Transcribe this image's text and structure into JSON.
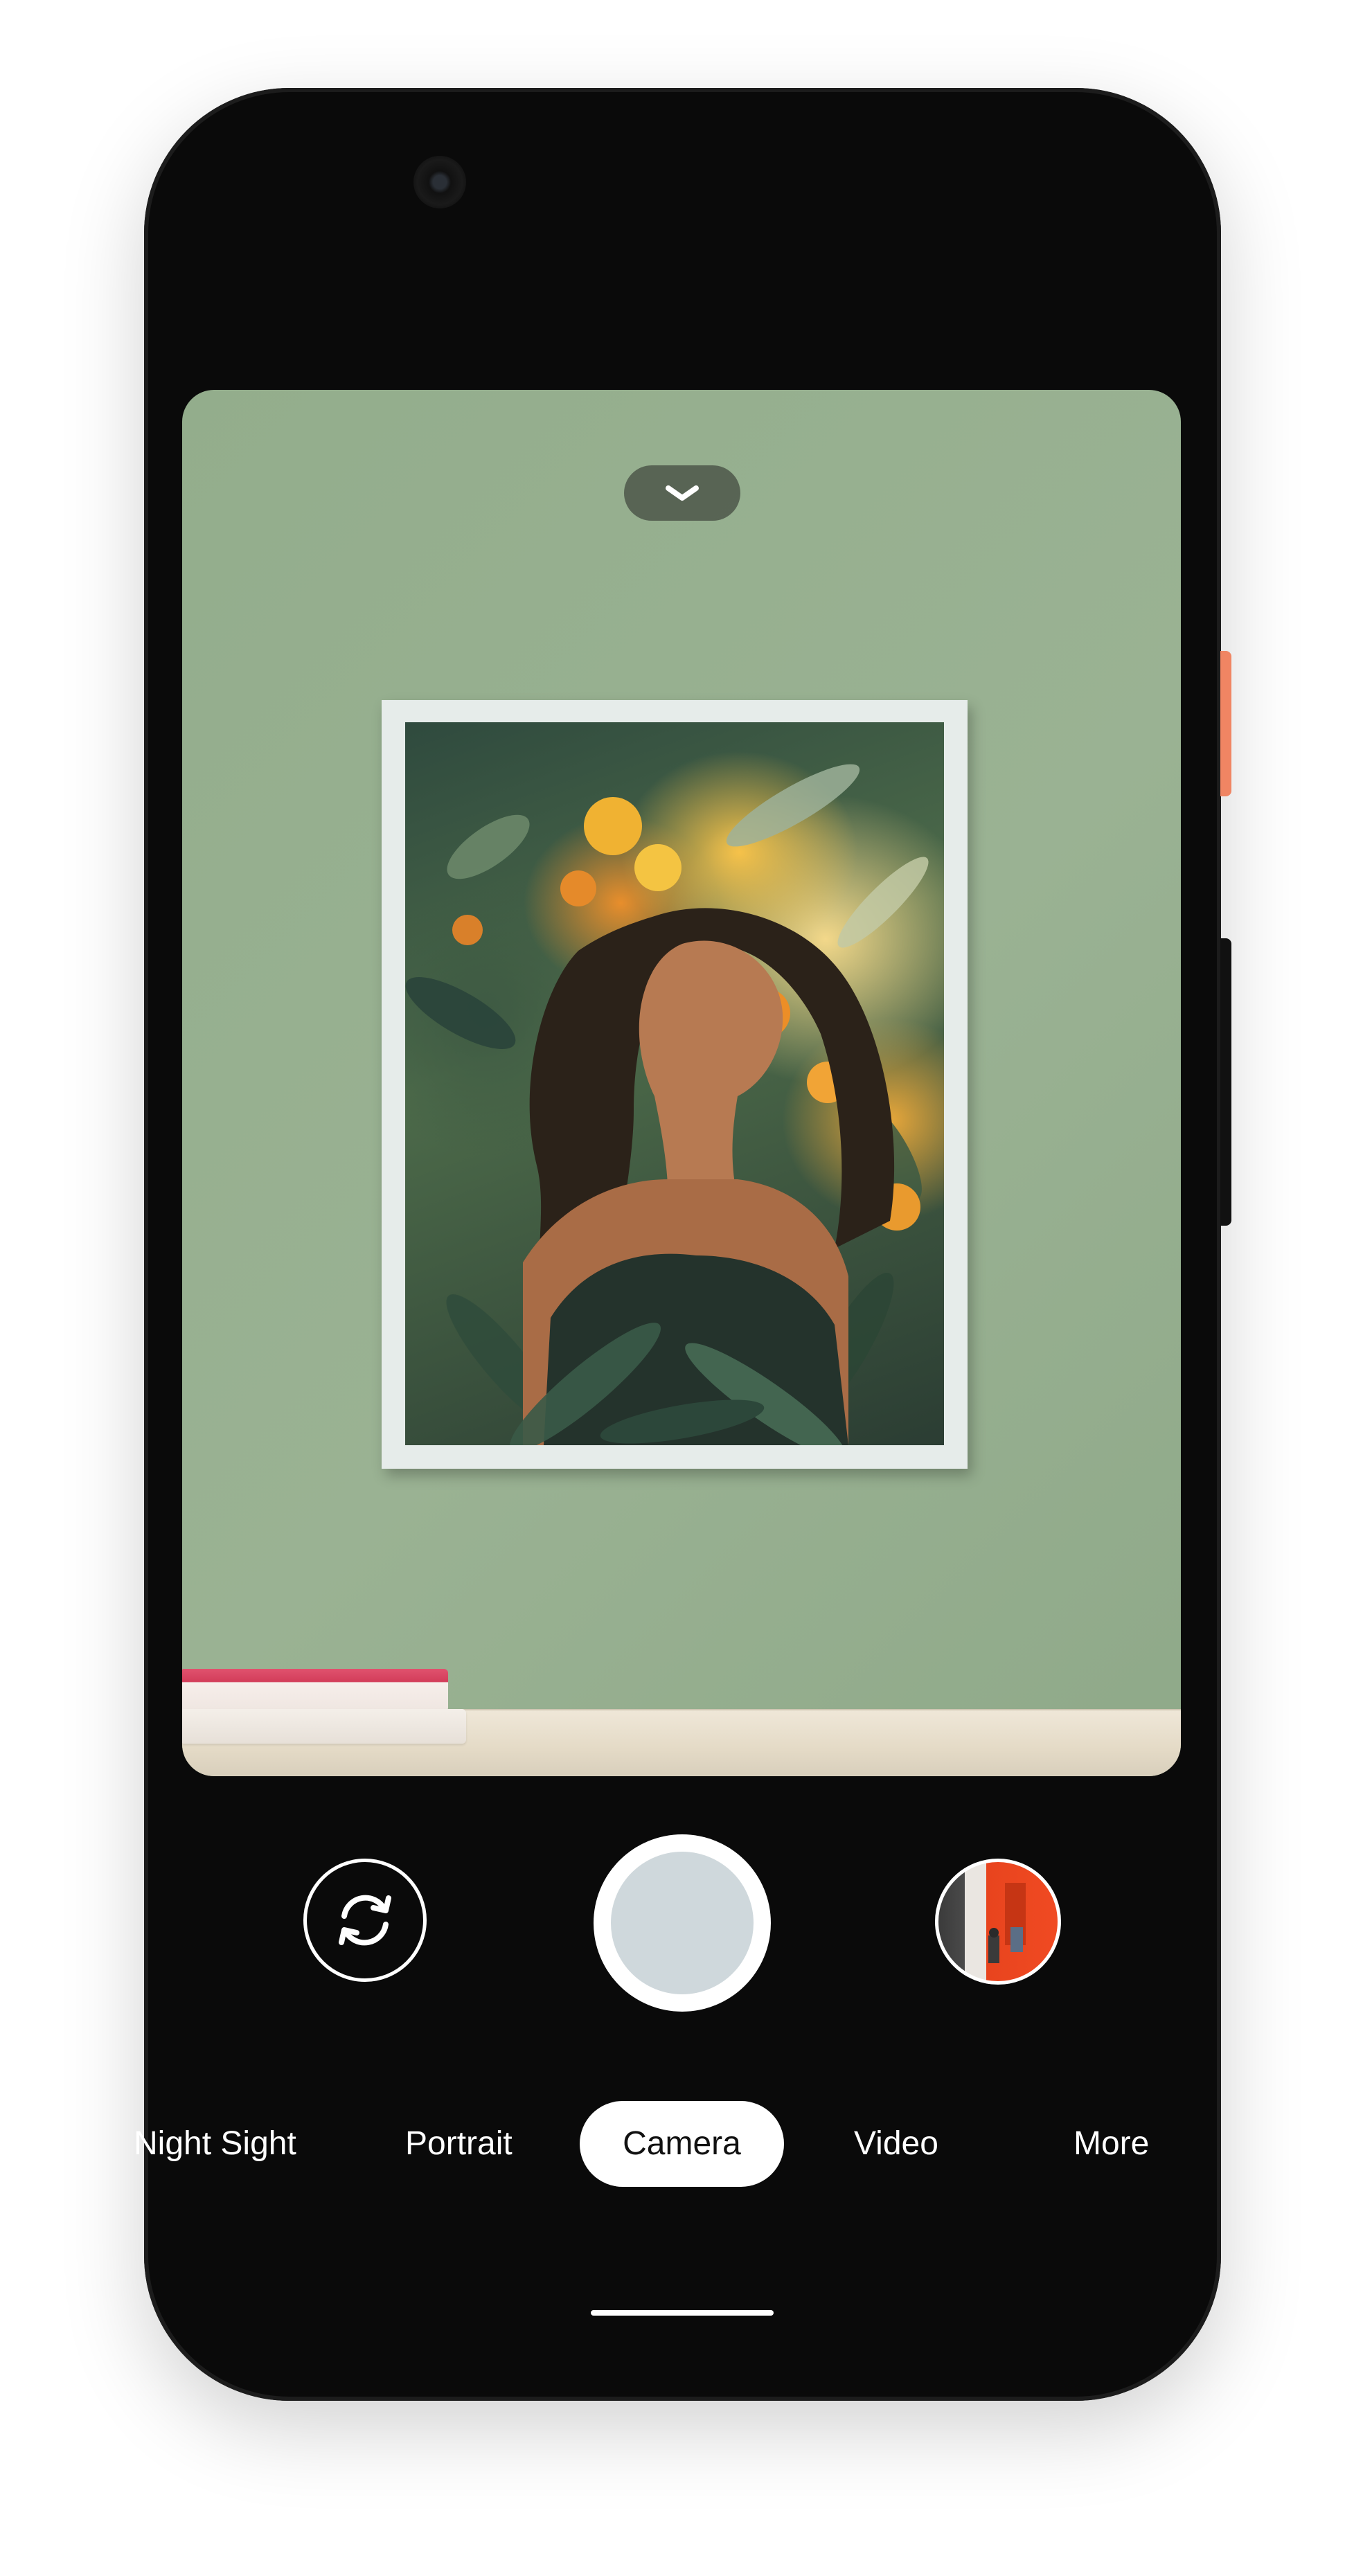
{
  "device": {
    "accent_side_key_color": "#f08563",
    "body_color": "#0a0a0a"
  },
  "viewfinder": {
    "collapse_icon": "chevron-down-icon",
    "scene": {
      "wall_color": "#93ad8c",
      "book_color": "#d33d5a"
    }
  },
  "controls": {
    "flip_icon": "camera-flip-icon",
    "shutter_color": "#cfd8dc",
    "gallery_icon": "last-photo-thumbnail"
  },
  "modes": {
    "items": [
      {
        "label": "Night Sight"
      },
      {
        "label": "Portrait"
      },
      {
        "label": "Camera",
        "selected": true
      },
      {
        "label": "Video"
      },
      {
        "label": "More"
      }
    ]
  }
}
